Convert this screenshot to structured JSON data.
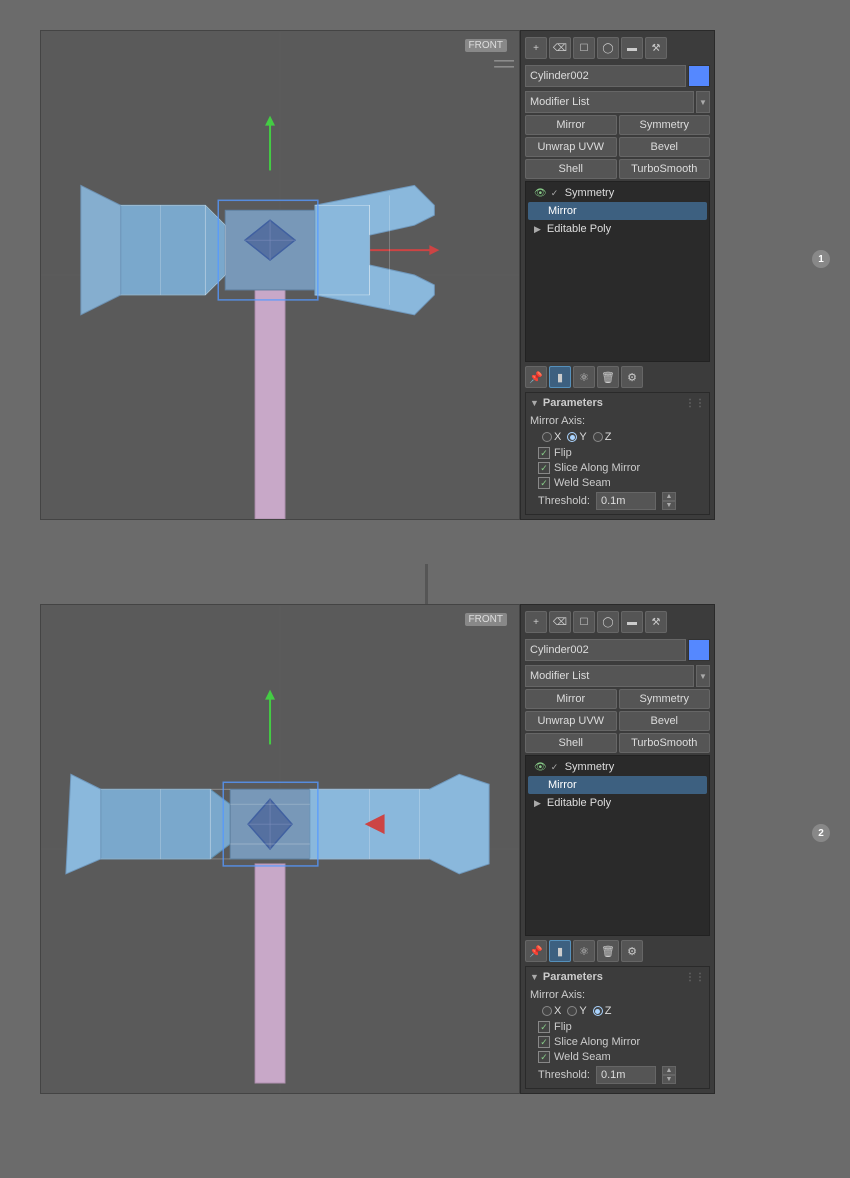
{
  "app": {
    "background": "#6b6b6b"
  },
  "panels": [
    {
      "id": "panel1",
      "badge": "1",
      "viewport": {
        "label": "FRONT"
      },
      "rightPanel": {
        "objectName": "Cylinder002",
        "colorSwatch": "#5588ff",
        "modifierListPlaceholder": "Modifier List",
        "modifiers": {
          "buttons": [
            "Mirror",
            "Symmetry",
            "Unwrap UVW",
            "Bevel",
            "Shell",
            "TurboSmooth"
          ]
        },
        "stack": [
          {
            "label": "Symmetry",
            "type": "parent",
            "eyeVisible": true,
            "active": false
          },
          {
            "label": "Mirror",
            "type": "child",
            "eyeVisible": false,
            "active": true
          },
          {
            "label": "Editable Poly",
            "type": "expandable",
            "eyeVisible": false,
            "active": false
          }
        ],
        "parameters": {
          "title": "Parameters",
          "mirrorAxis": {
            "label": "Mirror Axis:",
            "options": [
              "X",
              "Y",
              "Z"
            ],
            "selected": "Y"
          },
          "flip": {
            "label": "Flip",
            "checked": true
          },
          "sliceAlongMirror": {
            "label": "Slice Along Mirror",
            "checked": true
          },
          "weldSeam": {
            "label": "Weld Seam",
            "checked": true
          },
          "threshold": {
            "label": "Threshold:",
            "value": "0.1m"
          }
        }
      }
    },
    {
      "id": "panel2",
      "badge": "2",
      "viewport": {
        "label": "FRONT"
      },
      "rightPanel": {
        "objectName": "Cylinder002",
        "colorSwatch": "#5588ff",
        "modifierListPlaceholder": "Modifier List",
        "modifiers": {
          "buttons": [
            "Mirror",
            "Symmetry",
            "Unwrap UVW",
            "Bevel",
            "Shell",
            "TurboSmooth"
          ]
        },
        "stack": [
          {
            "label": "Symmetry",
            "type": "parent",
            "eyeVisible": true,
            "active": false
          },
          {
            "label": "Mirror",
            "type": "child",
            "eyeVisible": false,
            "active": true
          },
          {
            "label": "Editable Poly",
            "type": "expandable",
            "eyeVisible": false,
            "active": false
          }
        ],
        "parameters": {
          "title": "Parameters",
          "mirrorAxis": {
            "label": "Mirror Axis:",
            "options": [
              "X",
              "Y",
              "Z"
            ],
            "selected": "Z"
          },
          "flip": {
            "label": "Flip",
            "checked": true
          },
          "sliceAlongMirror": {
            "label": "Slice Along Mirror",
            "checked": true
          },
          "weldSeam": {
            "label": "Weld Seam",
            "checked": true
          },
          "threshold": {
            "label": "Threshold:",
            "value": "0.1m"
          }
        }
      }
    }
  ],
  "toolbar": {
    "icons": [
      "plus-icon",
      "graph-icon",
      "object-icon",
      "sphere-icon",
      "plane-icon",
      "wrench-icon"
    ]
  },
  "stackToolbar": {
    "buttons": [
      "pin-icon",
      "modifier-icon",
      "link-icon",
      "delete-icon",
      "config-icon"
    ]
  }
}
